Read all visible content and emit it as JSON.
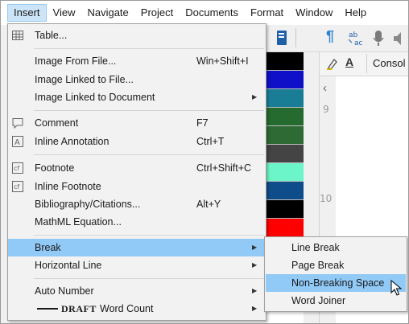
{
  "menubar": {
    "items": [
      "Insert",
      "View",
      "Navigate",
      "Project",
      "Documents",
      "Format",
      "Window",
      "Help"
    ]
  },
  "editor": {
    "tab_label": "Consol",
    "ruler_numbers": [
      "9",
      "10"
    ]
  },
  "swatch_colors": [
    "#000000",
    "#1010c8",
    "#1a7d96",
    "#256a2e",
    "#2e6a33",
    "#444444",
    "#6cf5c8",
    "#0f4c8a",
    "#000000",
    "#ff0000",
    "#ffffff",
    "#ffffff",
    "#ffffff",
    "#d1b84a"
  ],
  "insert_menu": {
    "table": "Table...",
    "image_from_file": "Image From File...",
    "image_from_file_shortcut": "Win+Shift+I",
    "image_linked_to_file": "Image Linked to File...",
    "image_linked_to_document": "Image Linked to Document",
    "comment": "Comment",
    "comment_shortcut": "F7",
    "inline_annotation": "Inline Annotation",
    "inline_annotation_shortcut": "Ctrl+T",
    "footnote": "Footnote",
    "footnote_shortcut": "Ctrl+Shift+C",
    "inline_footnote": "Inline Footnote",
    "bibliography": "Bibliography/Citations...",
    "bibliography_shortcut": "Alt+Y",
    "mathml": "MathML Equation...",
    "break": "Break",
    "horizontal_line": "Horizontal Line",
    "auto_number": "Auto Number",
    "word_count_badge": "DRAFT",
    "word_count": "Word Count"
  },
  "break_submenu": {
    "line_break": "Line Break",
    "page_break": "Page Break",
    "non_breaking_space": "Non-Breaking Space",
    "word_joiner": "Word Joiner"
  },
  "colors": {
    "highlight": "#91c9f7",
    "active_menu_bg": "#cce4f7",
    "menu_bg": "#f2f2f2"
  }
}
